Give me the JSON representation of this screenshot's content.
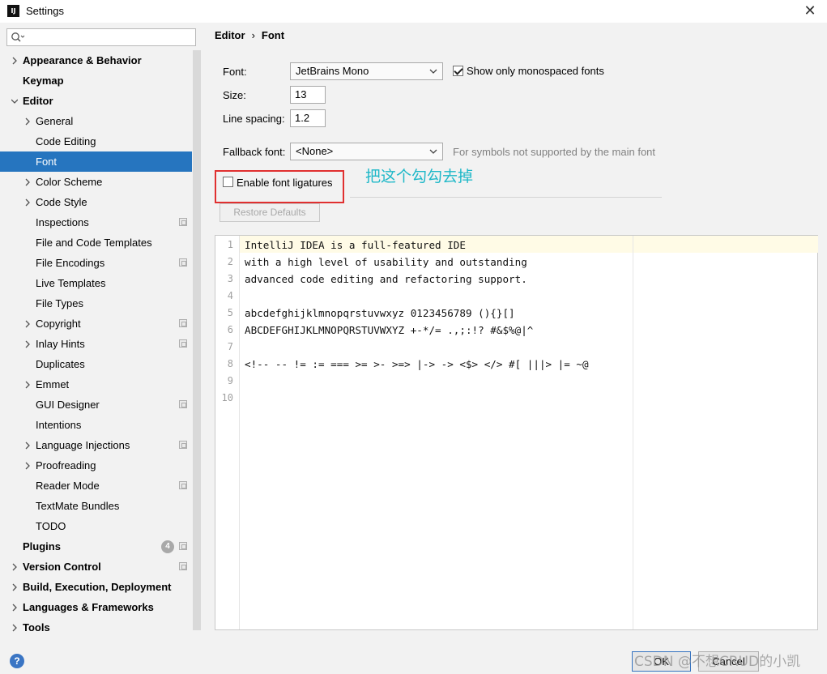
{
  "window": {
    "title": "Settings",
    "app_icon_text": "IJ",
    "close_glyph": "✕"
  },
  "sidebar": {
    "search_placeholder": "",
    "items": [
      {
        "label": "Appearance & Behavior",
        "level": 0,
        "expandable": true,
        "expanded": false
      },
      {
        "label": "Keymap",
        "level": 0,
        "expandable": false
      },
      {
        "label": "Editor",
        "level": 0,
        "expandable": true,
        "expanded": true
      },
      {
        "label": "General",
        "level": 1,
        "expandable": true,
        "expanded": false
      },
      {
        "label": "Code Editing",
        "level": 1,
        "expandable": false
      },
      {
        "label": "Font",
        "level": 1,
        "expandable": false,
        "selected": true
      },
      {
        "label": "Color Scheme",
        "level": 1,
        "expandable": true,
        "expanded": false
      },
      {
        "label": "Code Style",
        "level": 1,
        "expandable": true,
        "expanded": false
      },
      {
        "label": "Inspections",
        "level": 1,
        "expandable": false,
        "project_icon": true
      },
      {
        "label": "File and Code Templates",
        "level": 1,
        "expandable": false
      },
      {
        "label": "File Encodings",
        "level": 1,
        "expandable": false,
        "project_icon": true
      },
      {
        "label": "Live Templates",
        "level": 1,
        "expandable": false
      },
      {
        "label": "File Types",
        "level": 1,
        "expandable": false
      },
      {
        "label": "Copyright",
        "level": 1,
        "expandable": true,
        "expanded": false,
        "project_icon": true
      },
      {
        "label": "Inlay Hints",
        "level": 1,
        "expandable": true,
        "expanded": false,
        "project_icon": true
      },
      {
        "label": "Duplicates",
        "level": 1,
        "expandable": false
      },
      {
        "label": "Emmet",
        "level": 1,
        "expandable": true,
        "expanded": false
      },
      {
        "label": "GUI Designer",
        "level": 1,
        "expandable": false,
        "project_icon": true
      },
      {
        "label": "Intentions",
        "level": 1,
        "expandable": false
      },
      {
        "label": "Language Injections",
        "level": 1,
        "expandable": true,
        "expanded": false,
        "project_icon": true
      },
      {
        "label": "Proofreading",
        "level": 1,
        "expandable": true,
        "expanded": false
      },
      {
        "label": "Reader Mode",
        "level": 1,
        "expandable": false,
        "project_icon": true
      },
      {
        "label": "TextMate Bundles",
        "level": 1,
        "expandable": false
      },
      {
        "label": "TODO",
        "level": 1,
        "expandable": false
      },
      {
        "label": "Plugins",
        "level": 0,
        "expandable": false,
        "badge": "4",
        "project_icon": true
      },
      {
        "label": "Version Control",
        "level": 0,
        "expandable": true,
        "expanded": false,
        "project_icon": true
      },
      {
        "label": "Build, Execution, Deployment",
        "level": 0,
        "expandable": true,
        "expanded": false
      },
      {
        "label": "Languages & Frameworks",
        "level": 0,
        "expandable": true,
        "expanded": false
      },
      {
        "label": "Tools",
        "level": 0,
        "expandable": true,
        "expanded": false
      }
    ]
  },
  "breadcrumb": {
    "parent": "Editor",
    "separator": "›",
    "current": "Font"
  },
  "font_settings": {
    "font_label": "Font:",
    "font_value": "JetBrains Mono",
    "mono_only_label": "Show only monospaced fonts",
    "mono_only_checked": true,
    "size_label": "Size:",
    "size_value": "13",
    "line_spacing_label": "Line spacing:",
    "line_spacing_value": "1.2",
    "fallback_label": "Fallback font:",
    "fallback_value": "<None>",
    "fallback_hint": "For symbols not supported by the main font",
    "ligatures_label": "Enable font ligatures",
    "ligatures_checked": false,
    "restore_label": "Restore Defaults"
  },
  "annotation": {
    "text": "把这个勾勾去掉",
    "color": "#1fb8c8",
    "box_color": "#e03030"
  },
  "preview": {
    "lines": [
      {
        "n": "1",
        "text": "IntelliJ IDEA is a full-featured IDE"
      },
      {
        "n": "2",
        "text": "with a high level of usability and outstanding"
      },
      {
        "n": "3",
        "text": "advanced code editing and refactoring support."
      },
      {
        "n": "4",
        "text": ""
      },
      {
        "n": "5",
        "text": "abcdefghijklmnopqrstuvwxyz 0123456789 (){}[]"
      },
      {
        "n": "6",
        "text": "ABCDEFGHIJKLMNOPQRSTUVWXYZ +-*/= .,;:!? #&$%@|^"
      },
      {
        "n": "7",
        "text": ""
      },
      {
        "n": "8",
        "text": "<!-- -- != := === >= >- >=> |-> -> <$> </> #[ |||> |= ~@"
      },
      {
        "n": "9",
        "text": ""
      },
      {
        "n": "10",
        "text": ""
      }
    ]
  },
  "footer": {
    "help_glyph": "?",
    "ok_label": "OK",
    "cancel_label": "Cancel",
    "watermark": "CSDN @不想CRUD的小凯"
  },
  "colors": {
    "selection": "#2675bf",
    "accent": "#3a75c4"
  }
}
